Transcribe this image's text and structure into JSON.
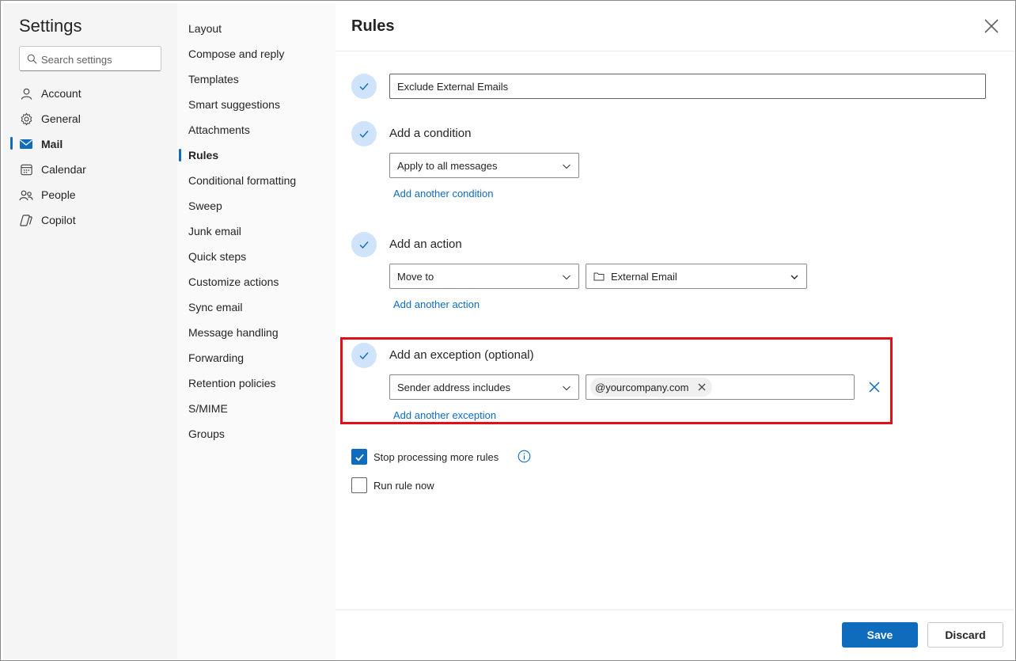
{
  "settings": {
    "title": "Settings",
    "search_placeholder": "Search settings"
  },
  "nav": {
    "items": [
      {
        "label": "Account",
        "icon": "person-icon"
      },
      {
        "label": "General",
        "icon": "gear-icon"
      },
      {
        "label": "Mail",
        "icon": "mail-icon",
        "active": true
      },
      {
        "label": "Calendar",
        "icon": "calendar-icon"
      },
      {
        "label": "People",
        "icon": "people-icon"
      },
      {
        "label": "Copilot",
        "icon": "copilot-icon"
      }
    ]
  },
  "mail_settings": {
    "items": [
      "Layout",
      "Compose and reply",
      "Templates",
      "Smart suggestions",
      "Attachments",
      "Rules",
      "Conditional formatting",
      "Sweep",
      "Junk email",
      "Quick steps",
      "Customize actions",
      "Sync email",
      "Message handling",
      "Forwarding",
      "Retention policies",
      "S/MIME",
      "Groups"
    ],
    "active": "Rules"
  },
  "rules": {
    "title": "Rules",
    "rule_name": "Exclude External Emails",
    "condition": {
      "label": "Add a condition",
      "selected": "Apply to all messages",
      "add_link": "Add another condition"
    },
    "action": {
      "label": "Add an action",
      "selected": "Move to",
      "folder": "External Email",
      "add_link": "Add another action"
    },
    "exception": {
      "label": "Add an exception (optional)",
      "selected": "Sender address includes",
      "chip": "@yourcompany.com",
      "add_link": "Add another exception"
    },
    "stop_processing": {
      "label": "Stop processing more rules",
      "checked": true
    },
    "run_now": {
      "label": "Run rule now",
      "checked": false
    }
  },
  "footer": {
    "save_label": "Save",
    "discard_label": "Discard"
  },
  "colors": {
    "accent": "#0f6cbd",
    "step_circle": "#cfe4fa",
    "highlight": "#e0101b"
  }
}
